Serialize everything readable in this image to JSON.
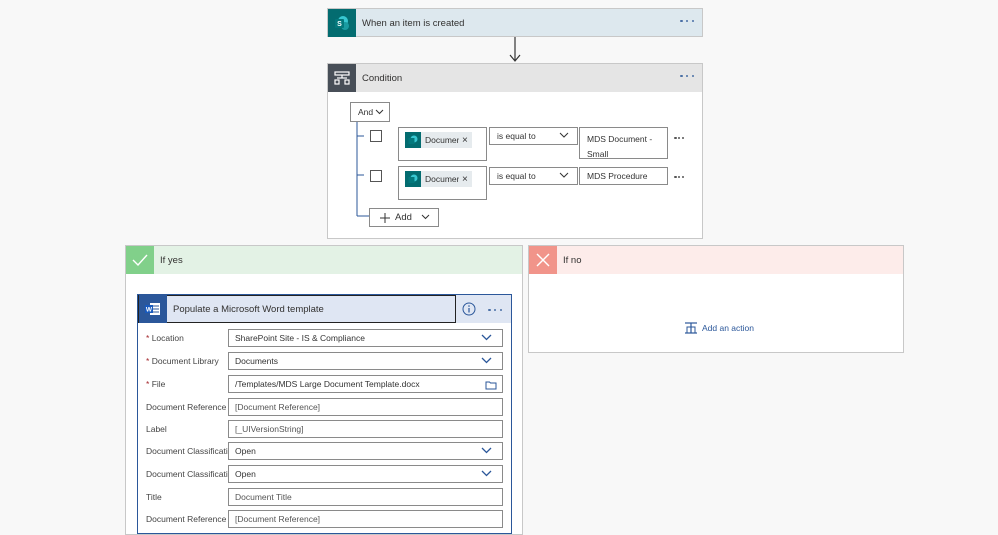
{
  "trigger": {
    "title": "When an item is created",
    "colors": {
      "header_bg": "#dde8ee",
      "icon_bg": "#036c70"
    }
  },
  "condition": {
    "title": "Condition",
    "group_operator": "And",
    "rows": [
      {
        "token_label": "Document...",
        "operator": "is equal to",
        "value_line1": "MDS Document -",
        "value_line2": "Small"
      },
      {
        "token_label": "Document...",
        "operator": "is equal to",
        "value_line1": "MDS Procedure",
        "value_line2": ""
      }
    ],
    "add_label": "Add",
    "colors": {
      "header_bg": "#e5e5e5",
      "icon_bg": "#484f58"
    }
  },
  "branch_yes": {
    "title": "If yes",
    "colors": {
      "header_bg": "#e3f2e5",
      "icon_bg": "#81d08a"
    }
  },
  "branch_no": {
    "title": "If no",
    "add_action": "Add an action",
    "colors": {
      "header_bg": "#fdecea",
      "icon_bg": "#f1948a"
    }
  },
  "word_action": {
    "title": "Populate a Microsoft Word template",
    "colors": {
      "header_bg": "#dfe6f3",
      "icon_bg": "#2b579a"
    },
    "fields": [
      {
        "label": "Location",
        "required": true,
        "value": "SharePoint Site - IS & Compliance",
        "kind": "dropdown"
      },
      {
        "label": "Document Library",
        "required": true,
        "value": "Documents",
        "kind": "dropdown"
      },
      {
        "label": "File",
        "required": true,
        "value": "/Templates/MDS Large Document Template.docx",
        "kind": "file"
      },
      {
        "label": "Document Reference",
        "required": false,
        "value": "[Document Reference]",
        "kind": "text"
      },
      {
        "label": "Label",
        "required": false,
        "value": "[_UIVersionString]",
        "kind": "text"
      },
      {
        "label": "Document Classification",
        "required": false,
        "value": "Open",
        "kind": "dropdown"
      },
      {
        "label": "Document Classification",
        "required": false,
        "value": "Open",
        "kind": "dropdown"
      },
      {
        "label": "Title",
        "required": false,
        "value": "Document Title",
        "kind": "text"
      },
      {
        "label": "Document Reference",
        "required": false,
        "value": "[Document Reference]",
        "kind": "text"
      }
    ]
  },
  "required_marker": "*"
}
